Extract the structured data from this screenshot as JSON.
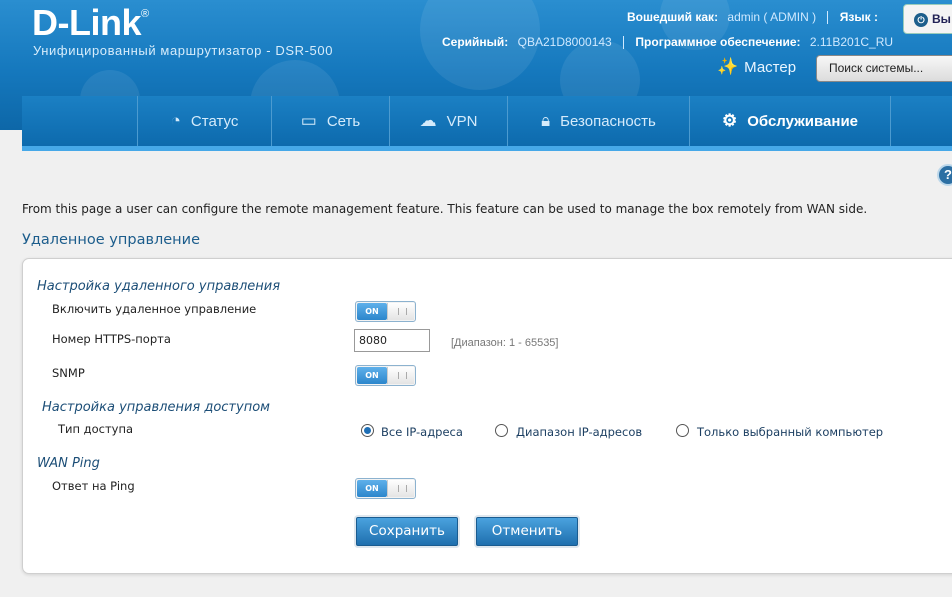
{
  "header": {
    "logo": "D-Link",
    "logo_reg": "®",
    "subtitle": "Унифицированный маршрутизатор - DSR-500",
    "logged_in_label": "Вошедший как:",
    "logged_in_value": "admin ( ADMIN )",
    "language_label": "Язык :",
    "logout_label": "Вы",
    "serial_label": "Серийный:",
    "serial_value": "QBA21D8000143",
    "firmware_label": "Программное обеспечение:",
    "firmware_value": "2.11B201C_RU",
    "wizard_label": "Мастер",
    "search_placeholder": "Поиск системы..."
  },
  "nav": {
    "items": [
      {
        "label": "Статус",
        "icon": "gauge-icon"
      },
      {
        "label": "Сеть",
        "icon": "computer-icon"
      },
      {
        "label": "VPN",
        "icon": "cloud-lock-icon"
      },
      {
        "label": "Безопасность",
        "icon": "lock-icon"
      },
      {
        "label": "Обслуживание",
        "icon": "gears-icon"
      }
    ],
    "active_index": 4
  },
  "help_label": "?",
  "description": "From this page a user can configure the remote management feature. This feature can be used to manage the box remotely from WAN side.",
  "page_title": "Удаленное управление",
  "form": {
    "section_remote": "Настройка удаленного управления",
    "enable_remote_label": "Включить удаленное управление",
    "enable_remote_state": "ON",
    "https_port_label": "Номер HTTPS-порта",
    "https_port_value": "8080",
    "https_port_range": "[Диапазон: 1 - 65535]",
    "snmp_label": "SNMP",
    "snmp_state": "ON",
    "section_access": "Настройка управления доступом",
    "access_type_label": "Тип доступа",
    "access_options": [
      "Все IP-адреса",
      "Диапазон IP-адресов",
      "Только выбранный компьютер"
    ],
    "access_selected": 0,
    "section_wan_ping": "WAN Ping",
    "ping_label": "Ответ на Ping",
    "ping_state": "ON",
    "save_label": "Сохранить",
    "cancel_label": "Отменить"
  },
  "colors": {
    "header_blue": "#1578bd",
    "accent": "#1f6fb5",
    "section_title": "#1c4e77"
  }
}
